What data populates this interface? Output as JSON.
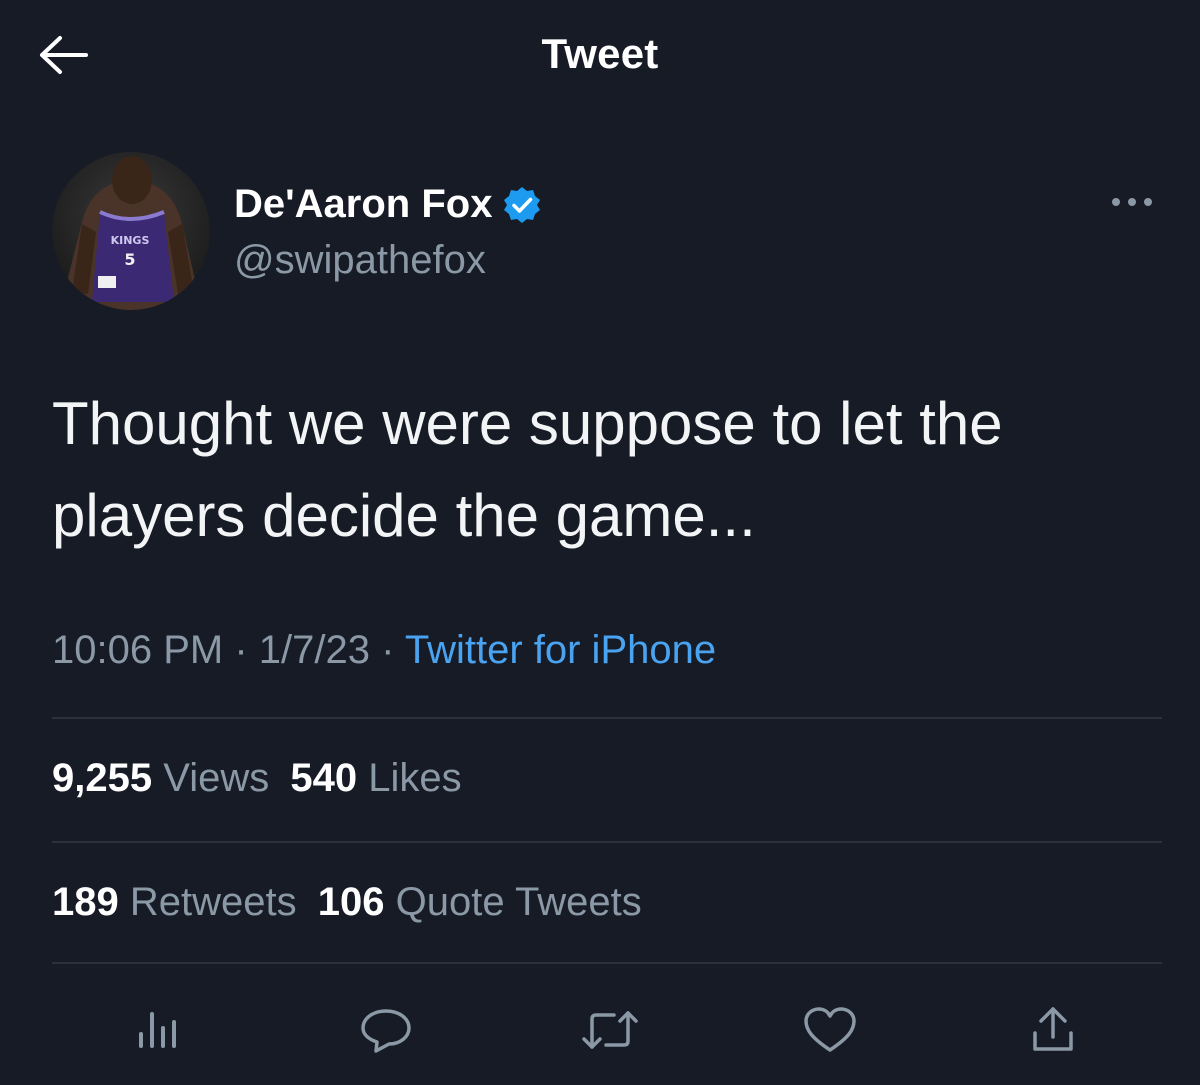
{
  "header": {
    "title": "Tweet",
    "back_icon": "arrow-left-icon"
  },
  "author": {
    "name": "De'Aaron Fox",
    "handle": "@swipathefox",
    "verified": true,
    "verified_color": "#1d9bf0",
    "avatar_jersey_number": "5",
    "avatar_jersey_text": "KINGS"
  },
  "tweet": {
    "text_line_1": "Thought we were suppose to let the",
    "text_line_2": "players decide the game...",
    "time": "10:06 PM",
    "date": "1/7/23",
    "separator": "·",
    "source": "Twitter for iPhone"
  },
  "stats": {
    "views_count": "9,255",
    "views_label": "Views",
    "likes_count": "540",
    "likes_label": "Likes",
    "retweets_count": "189",
    "retweets_label": "Retweets",
    "quotes_count": "106",
    "quotes_label": "Quote Tweets"
  },
  "actions": [
    {
      "icon": "analytics-icon"
    },
    {
      "icon": "reply-icon"
    },
    {
      "icon": "retweet-icon"
    },
    {
      "icon": "like-icon"
    },
    {
      "icon": "share-icon"
    }
  ],
  "colors": {
    "background": "#161b26",
    "secondary_text": "#8b98a5",
    "link": "#4aa3f0",
    "divider": "#2b313c"
  }
}
